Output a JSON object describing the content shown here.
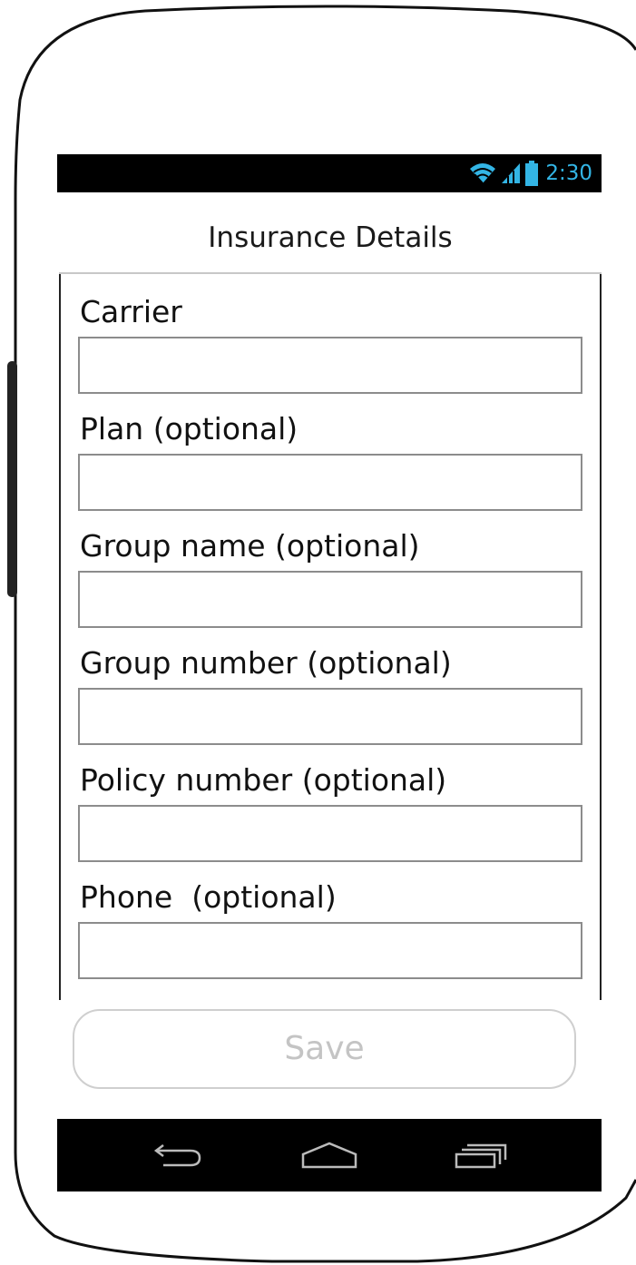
{
  "status_bar": {
    "time": "2:30",
    "icons": [
      "wifi-icon",
      "signal-icon",
      "battery-icon"
    ],
    "accent_color": "#33b5e5"
  },
  "header": {
    "title": "Insurance Details"
  },
  "form": {
    "fields": [
      {
        "label": "Carrier",
        "value": ""
      },
      {
        "label": "Plan (optional)",
        "value": ""
      },
      {
        "label": "Group name (optional)",
        "value": ""
      },
      {
        "label": "Group number (optional)",
        "value": ""
      },
      {
        "label": "Policy number (optional)",
        "value": ""
      },
      {
        "label": "Phone  (optional)",
        "value": ""
      }
    ],
    "save_label": "Save"
  },
  "nav_bar": {
    "buttons": [
      "back-icon",
      "home-icon",
      "recent-apps-icon"
    ]
  }
}
